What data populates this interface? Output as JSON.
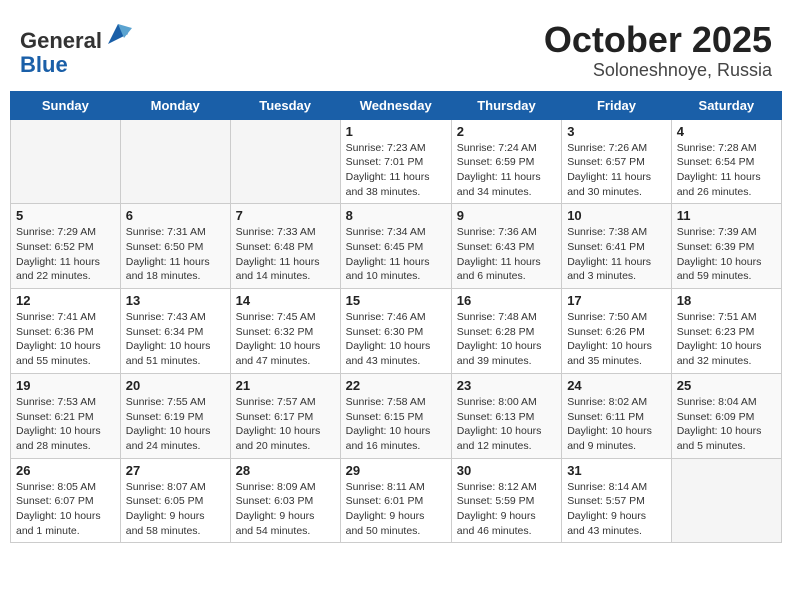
{
  "header": {
    "logo_line1": "General",
    "logo_line2": "Blue",
    "title": "October 2025",
    "subtitle": "Soloneshnoye, Russia"
  },
  "weekdays": [
    "Sunday",
    "Monday",
    "Tuesday",
    "Wednesday",
    "Thursday",
    "Friday",
    "Saturday"
  ],
  "weeks": [
    [
      {
        "day": "",
        "info": ""
      },
      {
        "day": "",
        "info": ""
      },
      {
        "day": "",
        "info": ""
      },
      {
        "day": "1",
        "info": "Sunrise: 7:23 AM\nSunset: 7:01 PM\nDaylight: 11 hours\nand 38 minutes."
      },
      {
        "day": "2",
        "info": "Sunrise: 7:24 AM\nSunset: 6:59 PM\nDaylight: 11 hours\nand 34 minutes."
      },
      {
        "day": "3",
        "info": "Sunrise: 7:26 AM\nSunset: 6:57 PM\nDaylight: 11 hours\nand 30 minutes."
      },
      {
        "day": "4",
        "info": "Sunrise: 7:28 AM\nSunset: 6:54 PM\nDaylight: 11 hours\nand 26 minutes."
      }
    ],
    [
      {
        "day": "5",
        "info": "Sunrise: 7:29 AM\nSunset: 6:52 PM\nDaylight: 11 hours\nand 22 minutes."
      },
      {
        "day": "6",
        "info": "Sunrise: 7:31 AM\nSunset: 6:50 PM\nDaylight: 11 hours\nand 18 minutes."
      },
      {
        "day": "7",
        "info": "Sunrise: 7:33 AM\nSunset: 6:48 PM\nDaylight: 11 hours\nand 14 minutes."
      },
      {
        "day": "8",
        "info": "Sunrise: 7:34 AM\nSunset: 6:45 PM\nDaylight: 11 hours\nand 10 minutes."
      },
      {
        "day": "9",
        "info": "Sunrise: 7:36 AM\nSunset: 6:43 PM\nDaylight: 11 hours\nand 6 minutes."
      },
      {
        "day": "10",
        "info": "Sunrise: 7:38 AM\nSunset: 6:41 PM\nDaylight: 11 hours\nand 3 minutes."
      },
      {
        "day": "11",
        "info": "Sunrise: 7:39 AM\nSunset: 6:39 PM\nDaylight: 10 hours\nand 59 minutes."
      }
    ],
    [
      {
        "day": "12",
        "info": "Sunrise: 7:41 AM\nSunset: 6:36 PM\nDaylight: 10 hours\nand 55 minutes."
      },
      {
        "day": "13",
        "info": "Sunrise: 7:43 AM\nSunset: 6:34 PM\nDaylight: 10 hours\nand 51 minutes."
      },
      {
        "day": "14",
        "info": "Sunrise: 7:45 AM\nSunset: 6:32 PM\nDaylight: 10 hours\nand 47 minutes."
      },
      {
        "day": "15",
        "info": "Sunrise: 7:46 AM\nSunset: 6:30 PM\nDaylight: 10 hours\nand 43 minutes."
      },
      {
        "day": "16",
        "info": "Sunrise: 7:48 AM\nSunset: 6:28 PM\nDaylight: 10 hours\nand 39 minutes."
      },
      {
        "day": "17",
        "info": "Sunrise: 7:50 AM\nSunset: 6:26 PM\nDaylight: 10 hours\nand 35 minutes."
      },
      {
        "day": "18",
        "info": "Sunrise: 7:51 AM\nSunset: 6:23 PM\nDaylight: 10 hours\nand 32 minutes."
      }
    ],
    [
      {
        "day": "19",
        "info": "Sunrise: 7:53 AM\nSunset: 6:21 PM\nDaylight: 10 hours\nand 28 minutes."
      },
      {
        "day": "20",
        "info": "Sunrise: 7:55 AM\nSunset: 6:19 PM\nDaylight: 10 hours\nand 24 minutes."
      },
      {
        "day": "21",
        "info": "Sunrise: 7:57 AM\nSunset: 6:17 PM\nDaylight: 10 hours\nand 20 minutes."
      },
      {
        "day": "22",
        "info": "Sunrise: 7:58 AM\nSunset: 6:15 PM\nDaylight: 10 hours\nand 16 minutes."
      },
      {
        "day": "23",
        "info": "Sunrise: 8:00 AM\nSunset: 6:13 PM\nDaylight: 10 hours\nand 12 minutes."
      },
      {
        "day": "24",
        "info": "Sunrise: 8:02 AM\nSunset: 6:11 PM\nDaylight: 10 hours\nand 9 minutes."
      },
      {
        "day": "25",
        "info": "Sunrise: 8:04 AM\nSunset: 6:09 PM\nDaylight: 10 hours\nand 5 minutes."
      }
    ],
    [
      {
        "day": "26",
        "info": "Sunrise: 8:05 AM\nSunset: 6:07 PM\nDaylight: 10 hours\nand 1 minute."
      },
      {
        "day": "27",
        "info": "Sunrise: 8:07 AM\nSunset: 6:05 PM\nDaylight: 9 hours\nand 58 minutes."
      },
      {
        "day": "28",
        "info": "Sunrise: 8:09 AM\nSunset: 6:03 PM\nDaylight: 9 hours\nand 54 minutes."
      },
      {
        "day": "29",
        "info": "Sunrise: 8:11 AM\nSunset: 6:01 PM\nDaylight: 9 hours\nand 50 minutes."
      },
      {
        "day": "30",
        "info": "Sunrise: 8:12 AM\nSunset: 5:59 PM\nDaylight: 9 hours\nand 46 minutes."
      },
      {
        "day": "31",
        "info": "Sunrise: 8:14 AM\nSunset: 5:57 PM\nDaylight: 9 hours\nand 43 minutes."
      },
      {
        "day": "",
        "info": ""
      }
    ]
  ]
}
